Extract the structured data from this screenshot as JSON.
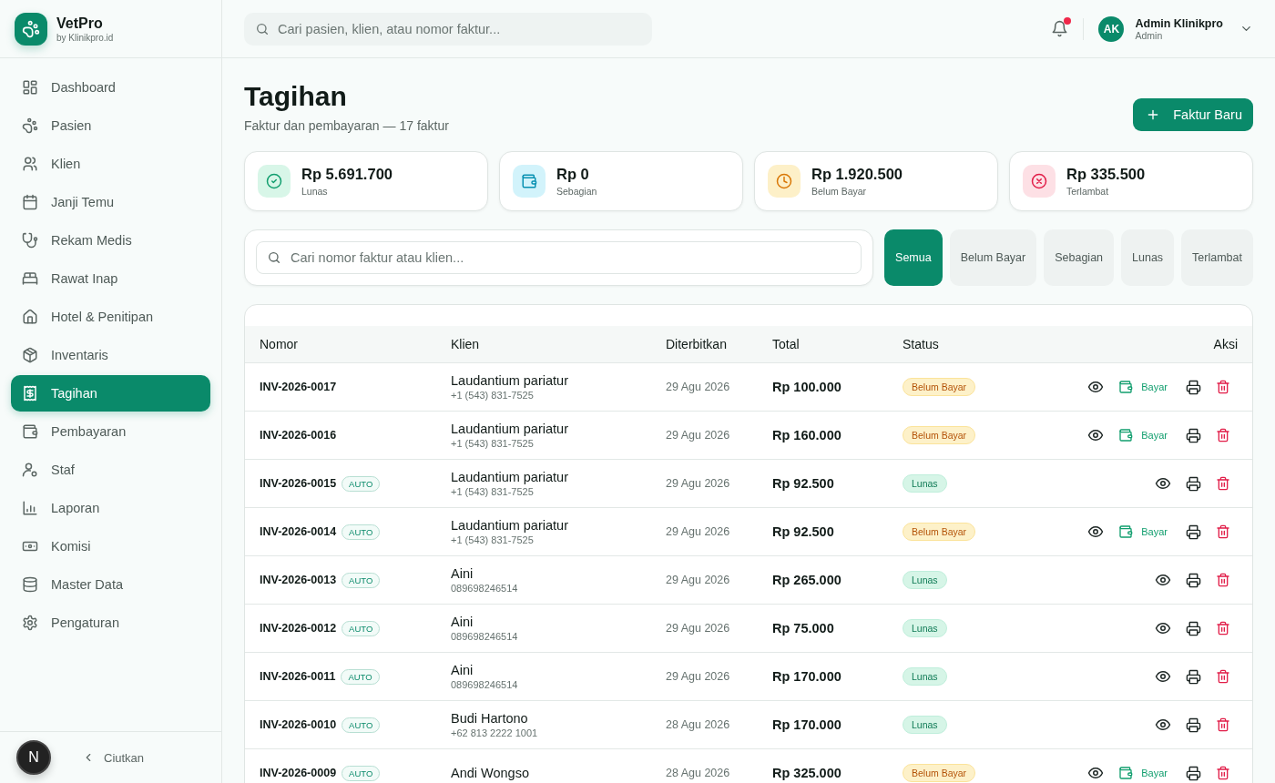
{
  "brand": {
    "name": "VetPro",
    "tagline": "by Klinikpro.id"
  },
  "sidebar": {
    "items": [
      {
        "label": "Dashboard",
        "selected": false
      },
      {
        "label": "Pasien",
        "selected": false
      },
      {
        "label": "Klien",
        "selected": false
      },
      {
        "label": "Janji Temu",
        "selected": false
      },
      {
        "label": "Rekam Medis",
        "selected": false
      },
      {
        "label": "Rawat Inap",
        "selected": false
      },
      {
        "label": "Hotel & Penitipan",
        "selected": false
      },
      {
        "label": "Inventaris",
        "selected": false
      },
      {
        "label": "Tagihan",
        "selected": true
      },
      {
        "label": "Pembayaran",
        "selected": false
      },
      {
        "label": "Staf",
        "selected": false
      },
      {
        "label": "Laporan",
        "selected": false
      },
      {
        "label": "Komisi",
        "selected": false
      },
      {
        "label": "Master Data",
        "selected": false
      },
      {
        "label": "Pengaturan",
        "selected": false
      }
    ],
    "collapse_label": "Ciutkan",
    "dev_badge": "N"
  },
  "header": {
    "search": {
      "placeholder": "Cari pasien, klien, atau nomor faktur..."
    },
    "notifications_unread": true,
    "user": {
      "initials": "AK",
      "name": "Admin Klinikpro",
      "role": "Admin"
    }
  },
  "page": {
    "title": "Tagihan",
    "subtitle": "Faktur dan pembayaran — 17 faktur",
    "new_button": "Faktur Baru"
  },
  "stats": [
    {
      "kind": "paid",
      "value": "Rp 5.691.700",
      "label": "Lunas"
    },
    {
      "kind": "partial",
      "value": "Rp 0",
      "label": "Sebagian"
    },
    {
      "kind": "unpaid",
      "value": "Rp 1.920.500",
      "label": "Belum Bayar"
    },
    {
      "kind": "late",
      "value": "Rp 335.500",
      "label": "Terlambat"
    }
  ],
  "filter": {
    "search": {
      "placeholder": "Cari nomor faktur atau klien..."
    },
    "chips": [
      {
        "label": "Semua",
        "selected": true
      },
      {
        "label": "Belum Bayar",
        "selected": false
      },
      {
        "label": "Sebagian",
        "selected": false
      },
      {
        "label": "Lunas",
        "selected": false
      },
      {
        "label": "Terlambat",
        "selected": false
      }
    ]
  },
  "table": {
    "columns": [
      "Nomor",
      "Klien",
      "Diterbitkan",
      "Total",
      "Status",
      "Aksi"
    ],
    "rows": [
      {
        "number": "INV-2026-0017",
        "client": "Laudantium pariatur",
        "phone": "+1 (543) 831-7525",
        "date": "29 Agu 2026",
        "total": "Rp 100.000",
        "status": {
          "label": "Belum Bayar",
          "kind": "unpaid"
        },
        "pay": "Bayar"
      },
      {
        "number": "INV-2026-0016",
        "client": "Laudantium pariatur",
        "phone": "+1 (543) 831-7525",
        "date": "29 Agu 2026",
        "total": "Rp 160.000",
        "status": {
          "label": "Belum Bayar",
          "kind": "unpaid"
        },
        "pay": "Bayar"
      },
      {
        "number": "INV-2026-0015",
        "badge": "AUTO",
        "client": "Laudantium pariatur",
        "phone": "+1 (543) 831-7525",
        "date": "29 Agu 2026",
        "total": "Rp 92.500",
        "status": {
          "label": "Lunas",
          "kind": "paid"
        }
      },
      {
        "number": "INV-2026-0014",
        "badge": "AUTO",
        "client": "Laudantium pariatur",
        "phone": "+1 (543) 831-7525",
        "date": "29 Agu 2026",
        "total": "Rp 92.500",
        "status": {
          "label": "Belum Bayar",
          "kind": "unpaid"
        },
        "pay": "Bayar"
      },
      {
        "number": "INV-2026-0013",
        "badge": "AUTO",
        "client": "Aini",
        "phone": "089698246514",
        "date": "29 Agu 2026",
        "total": "Rp 265.000",
        "status": {
          "label": "Lunas",
          "kind": "paid"
        }
      },
      {
        "number": "INV-2026-0012",
        "badge": "AUTO",
        "client": "Aini",
        "phone": "089698246514",
        "date": "29 Agu 2026",
        "total": "Rp 75.000",
        "status": {
          "label": "Lunas",
          "kind": "paid"
        }
      },
      {
        "number": "INV-2026-0011",
        "badge": "AUTO",
        "client": "Aini",
        "phone": "089698246514",
        "date": "29 Agu 2026",
        "total": "Rp 170.000",
        "status": {
          "label": "Lunas",
          "kind": "paid"
        }
      },
      {
        "number": "INV-2026-0010",
        "badge": "AUTO",
        "client": "Budi Hartono",
        "phone": "+62 813 2222 1001",
        "date": "28 Agu 2026",
        "total": "Rp 170.000",
        "status": {
          "label": "Lunas",
          "kind": "paid"
        }
      },
      {
        "number": "INV-2026-0009",
        "badge": "AUTO",
        "client": "Andi Wongso",
        "date": "28 Agu 2026",
        "total": "Rp 325.000",
        "status": {
          "label": "Belum Bayar",
          "kind": "unpaid"
        },
        "pay": "Bayar"
      }
    ]
  }
}
